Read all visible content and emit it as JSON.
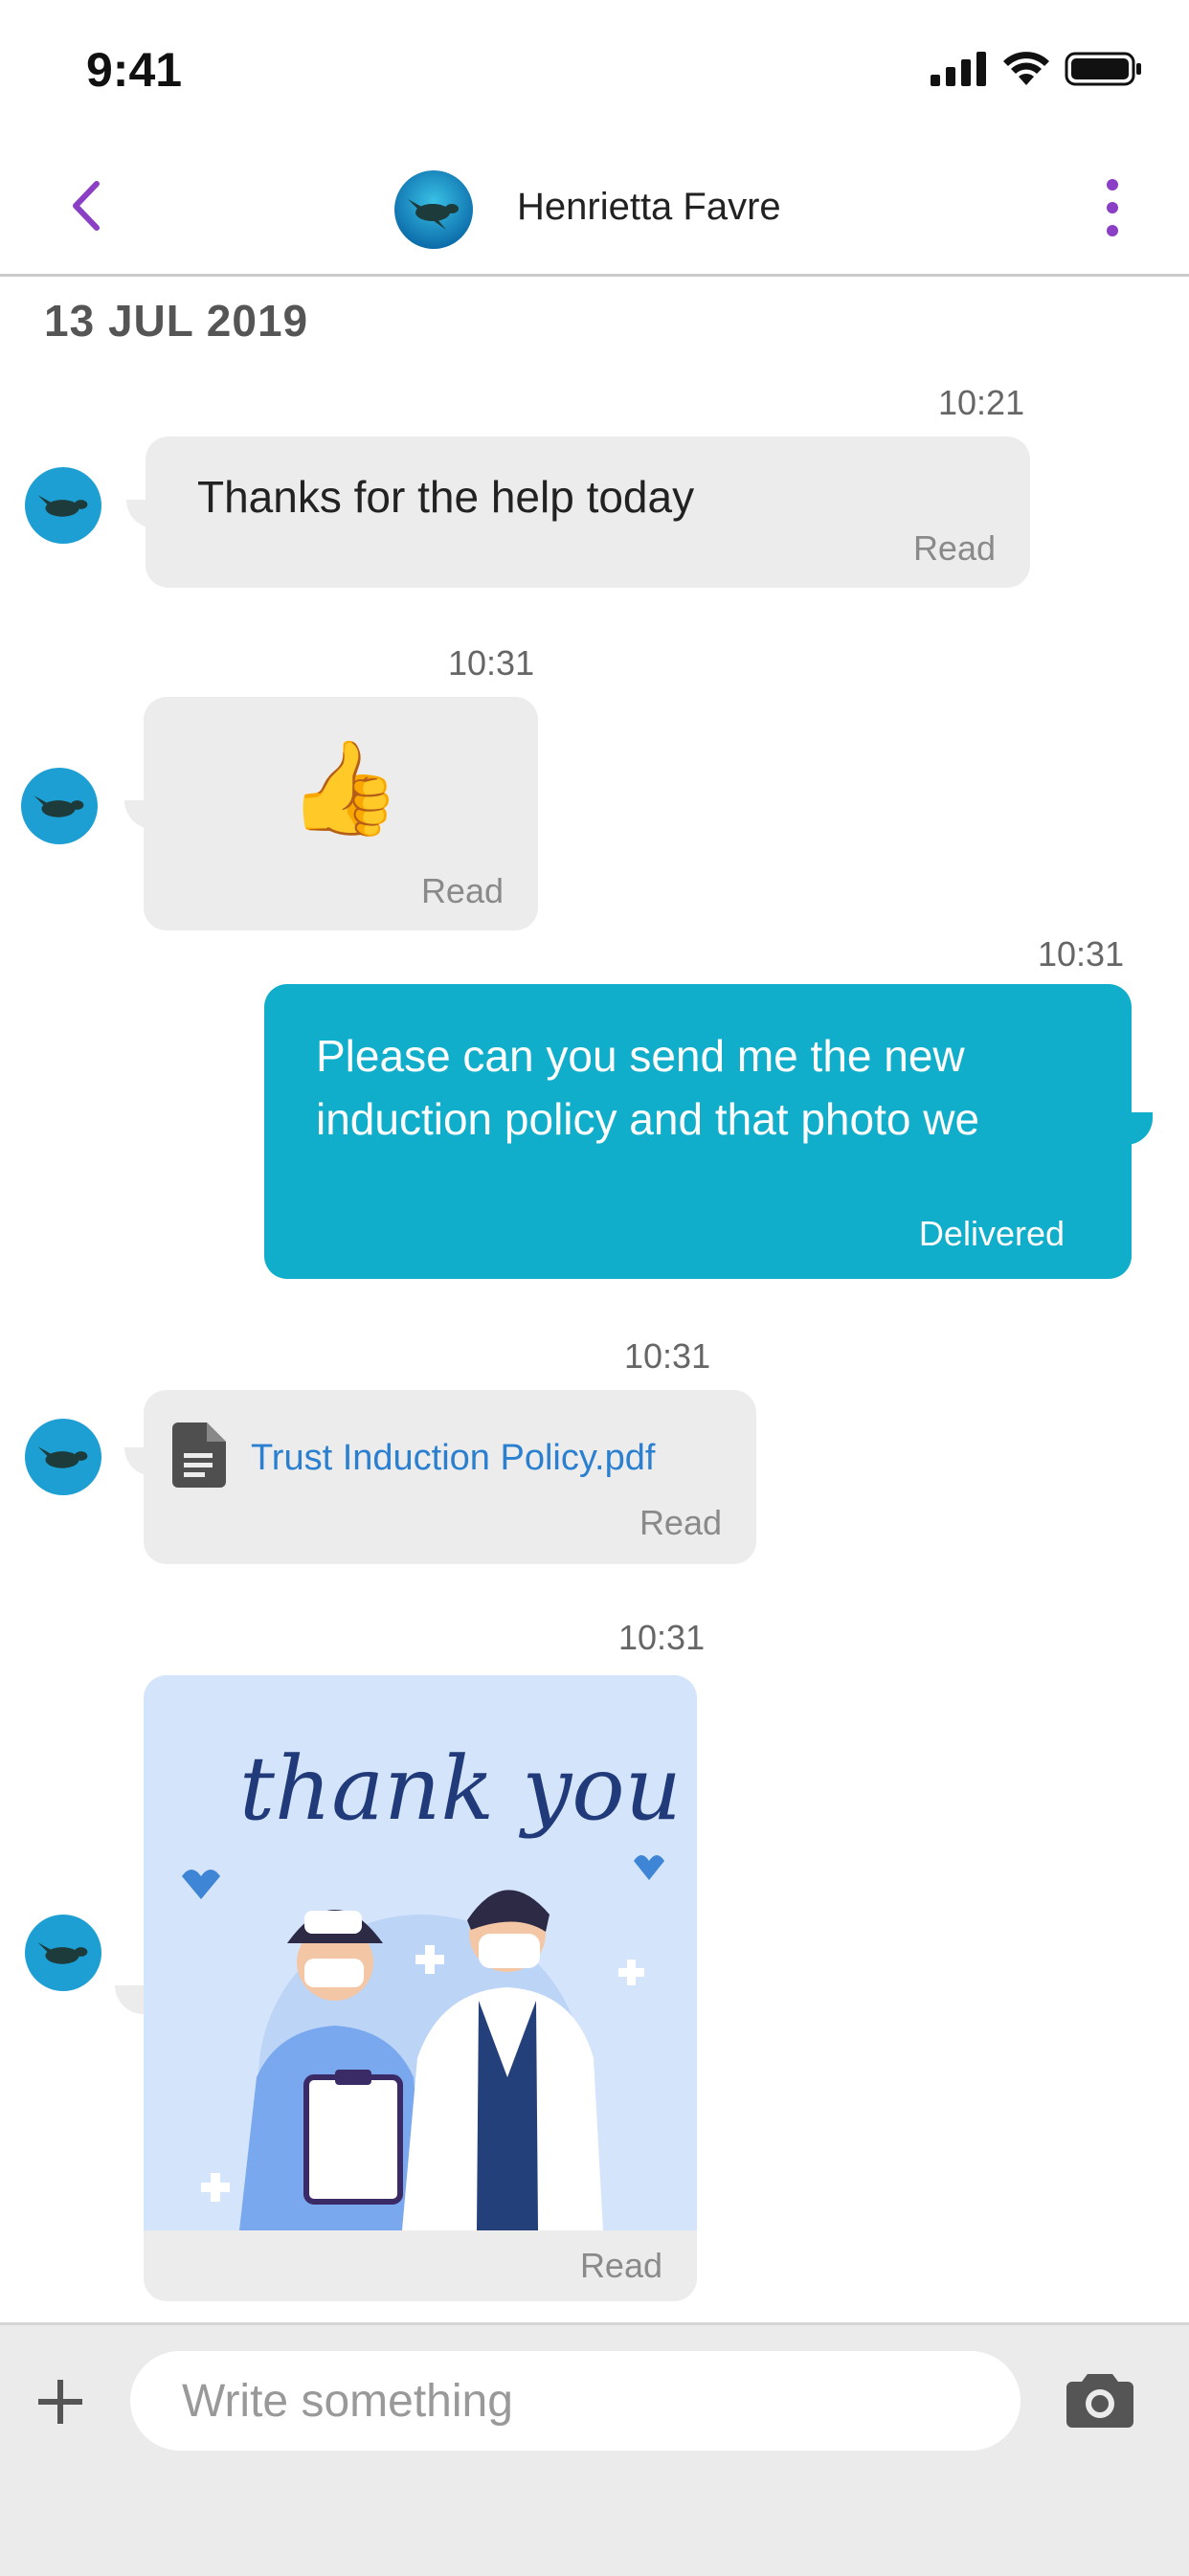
{
  "status_bar": {
    "time": "9:41"
  },
  "header": {
    "contact_name": "Henrietta Favre"
  },
  "date_separator": "13 JUL 2019",
  "messages": [
    {
      "time": "10:21",
      "text": "Thanks for the help today",
      "status": "Read"
    },
    {
      "time": "10:31",
      "emoji": "👍",
      "status": "Read"
    },
    {
      "time": "10:31",
      "text_line1": "Please can you send me the new",
      "text_line2": "induction policy and that photo we",
      "status": "Delivered"
    },
    {
      "time": "10:31",
      "file_name": "Trust Induction Policy.pdf",
      "status": "Read"
    },
    {
      "time": "10:31",
      "image_caption": "thank you",
      "status": "Read"
    }
  ],
  "composer": {
    "placeholder": "Write something"
  },
  "colors": {
    "accent": "#8a3fc4",
    "outgoing_bubble": "#11aecb",
    "incoming_bubble": "#ececec",
    "link": "#2a7fd0"
  }
}
